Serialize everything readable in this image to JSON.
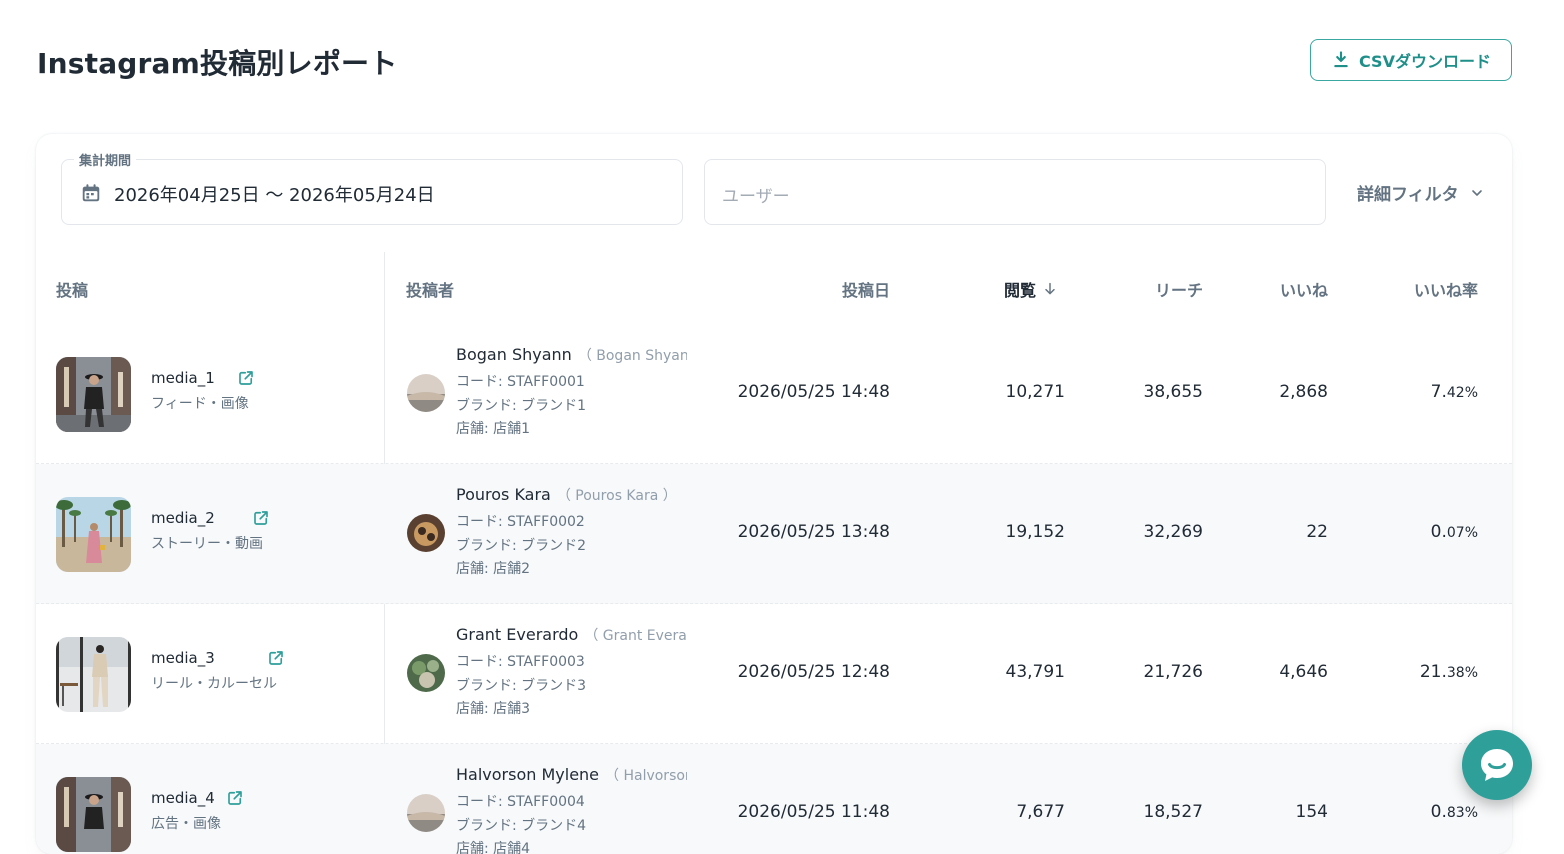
{
  "page": {
    "title": "Instagram投稿別レポート",
    "csv_button": "CSVダウンロード"
  },
  "filters": {
    "date_label": "集計期間",
    "date_value": "2026年04月25日 〜 2026年05月24日",
    "user_placeholder": "ユーザー",
    "detail_filter": "詳細フィルタ"
  },
  "table": {
    "columns": [
      "投稿",
      "投稿者",
      "投稿日",
      "閲覧",
      "リーチ",
      "いいね",
      "いいね率"
    ],
    "sorted_column": "閲覧",
    "sort_direction": "desc",
    "rows": [
      {
        "media": "media_1",
        "type": "フィード・画像",
        "name": "Bogan Shyann",
        "name_sub": "（ Bogan Shyann ）",
        "code": "コード: STAFF0001",
        "brand": "ブランド: ブランド1",
        "store": "店舗: 店舗1",
        "date": "2026/05/25 14:48",
        "views": "10,271",
        "reach": "38,655",
        "likes": "2,868",
        "rate_int": "7.",
        "rate_dec": "42%"
      },
      {
        "media": "media_2",
        "type": "ストーリー・動画",
        "name": "Pouros Kara",
        "name_sub": "（ Pouros Kara ）",
        "code": "コード: STAFF0002",
        "brand": "ブランド: ブランド2",
        "store": "店舗: 店舗2",
        "date": "2026/05/25 13:48",
        "views": "19,152",
        "reach": "32,269",
        "likes": "22",
        "rate_int": "0.",
        "rate_dec": "07%"
      },
      {
        "media": "media_3",
        "type": "リール・カルーセル",
        "name": "Grant Everardo",
        "name_sub": "（ Grant Everardo ）",
        "code": "コード: STAFF0003",
        "brand": "ブランド: ブランド3",
        "store": "店舗: 店舗3",
        "date": "2026/05/25 12:48",
        "views": "43,791",
        "reach": "21,726",
        "likes": "4,646",
        "rate_int": "21.",
        "rate_dec": "38%"
      },
      {
        "media": "media_4",
        "type": "広告・画像",
        "name": "Halvorson Mylene",
        "name_sub": "（ Halvorson Mylene ）",
        "code": "コード: STAFF0004",
        "brand": "ブランド: ブランド4",
        "store": "店舗: 店舗4",
        "date": "2026/05/25 11:48",
        "views": "7,677",
        "reach": "18,527",
        "likes": "154",
        "rate_int": "0.",
        "rate_dec": "83%"
      }
    ]
  },
  "colors": {
    "accent": "#2f9f9a",
    "text": "#212b36",
    "muted": "#637381"
  },
  "icons": [
    "download-icon",
    "calendar-icon",
    "chevron-down-icon",
    "arrow-down-icon",
    "external-link-icon",
    "chat-icon"
  ]
}
